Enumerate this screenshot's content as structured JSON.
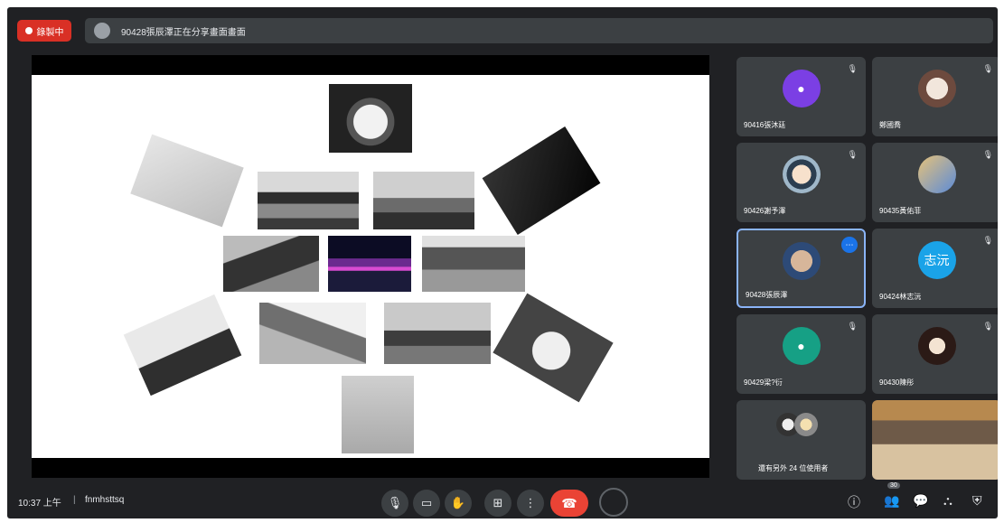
{
  "topbar": {
    "recording_label": "錄製中",
    "presenter_text": "90428張辰澤正在分享畫面畫面"
  },
  "participants": [
    {
      "name": "90416張沐廷",
      "avatar": "",
      "avatar_color": "#7b3fe4"
    },
    {
      "name": "鄭國喬",
      "avatar": "",
      "avatar_color": "#6d4a3e"
    },
    {
      "name": "90426謝予澤",
      "avatar": "",
      "avatar_color": "#9fb7c9"
    },
    {
      "name": "90435黃佑菲",
      "avatar": "",
      "avatar_color": "#e6c27a"
    },
    {
      "name": "90428張辰澤",
      "avatar": "",
      "avatar_color": "#d7b69a"
    },
    {
      "name": "90424林志沅",
      "avatar": "志沅",
      "avatar_color": "#1aa3e8"
    },
    {
      "name": "90429梁?衍",
      "avatar": "",
      "avatar_color": "#16a085"
    },
    {
      "name": "90430陳彤",
      "avatar": "",
      "avatar_color": "#2b1a16"
    },
    {
      "name": "還有另外 24 位使用者",
      "avatar": "",
      "avatar_color": "#8a8a8a"
    },
    {
      "name": "",
      "avatar": "",
      "avatar_color": "#6e5a48"
    }
  ],
  "bottom": {
    "time": "10:37 上午",
    "separator": "|",
    "meeting_code": "fnmhsttsq",
    "people_count": "30"
  },
  "icons": {
    "mic": "mic-icon",
    "camera": "camera-icon",
    "raise_hand": "hand-icon",
    "present": "present-icon",
    "more": "more-icon",
    "hangup": "phone-icon",
    "info": "info-icon",
    "people": "people-icon",
    "chat": "chat-icon",
    "activities": "activities-icon",
    "host": "shield-icon"
  }
}
